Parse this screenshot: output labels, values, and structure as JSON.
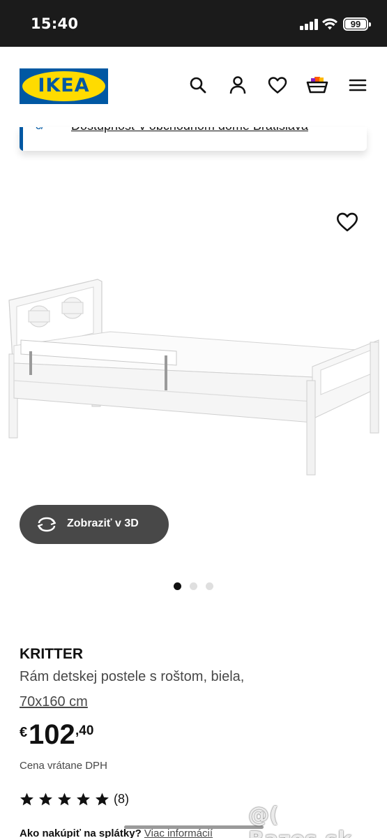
{
  "status_bar": {
    "time": "15:40",
    "battery": "99"
  },
  "header": {
    "logo_text": "IKEA",
    "icons": [
      "search-icon",
      "user-icon",
      "heart-icon",
      "basket-icon",
      "menu-icon"
    ]
  },
  "banner": {
    "link_text": "Dostupnosť v obchodnom dome Bratislava"
  },
  "gallery": {
    "view_3d_label": "Zobraziť v 3D",
    "active_slide": 1,
    "slide_count": 3
  },
  "product": {
    "name": "KRITTER",
    "description": "Rám detskej postele s roštom, biela,",
    "size": "70x160 cm",
    "price_currency": "€",
    "price_integer": "102",
    "price_decimals": ",40",
    "vat_note": "Cena vrátane DPH",
    "rating": 5,
    "review_count": "(8)",
    "installment_question": "Ako nakúpiť na splátky?",
    "installment_link": "Viac informácií"
  },
  "watermark": "@( Bazos.sk",
  "colors": {
    "ikea_blue": "#0058a3",
    "ikea_yellow": "#ffdb00",
    "button_dark": "#484848"
  }
}
